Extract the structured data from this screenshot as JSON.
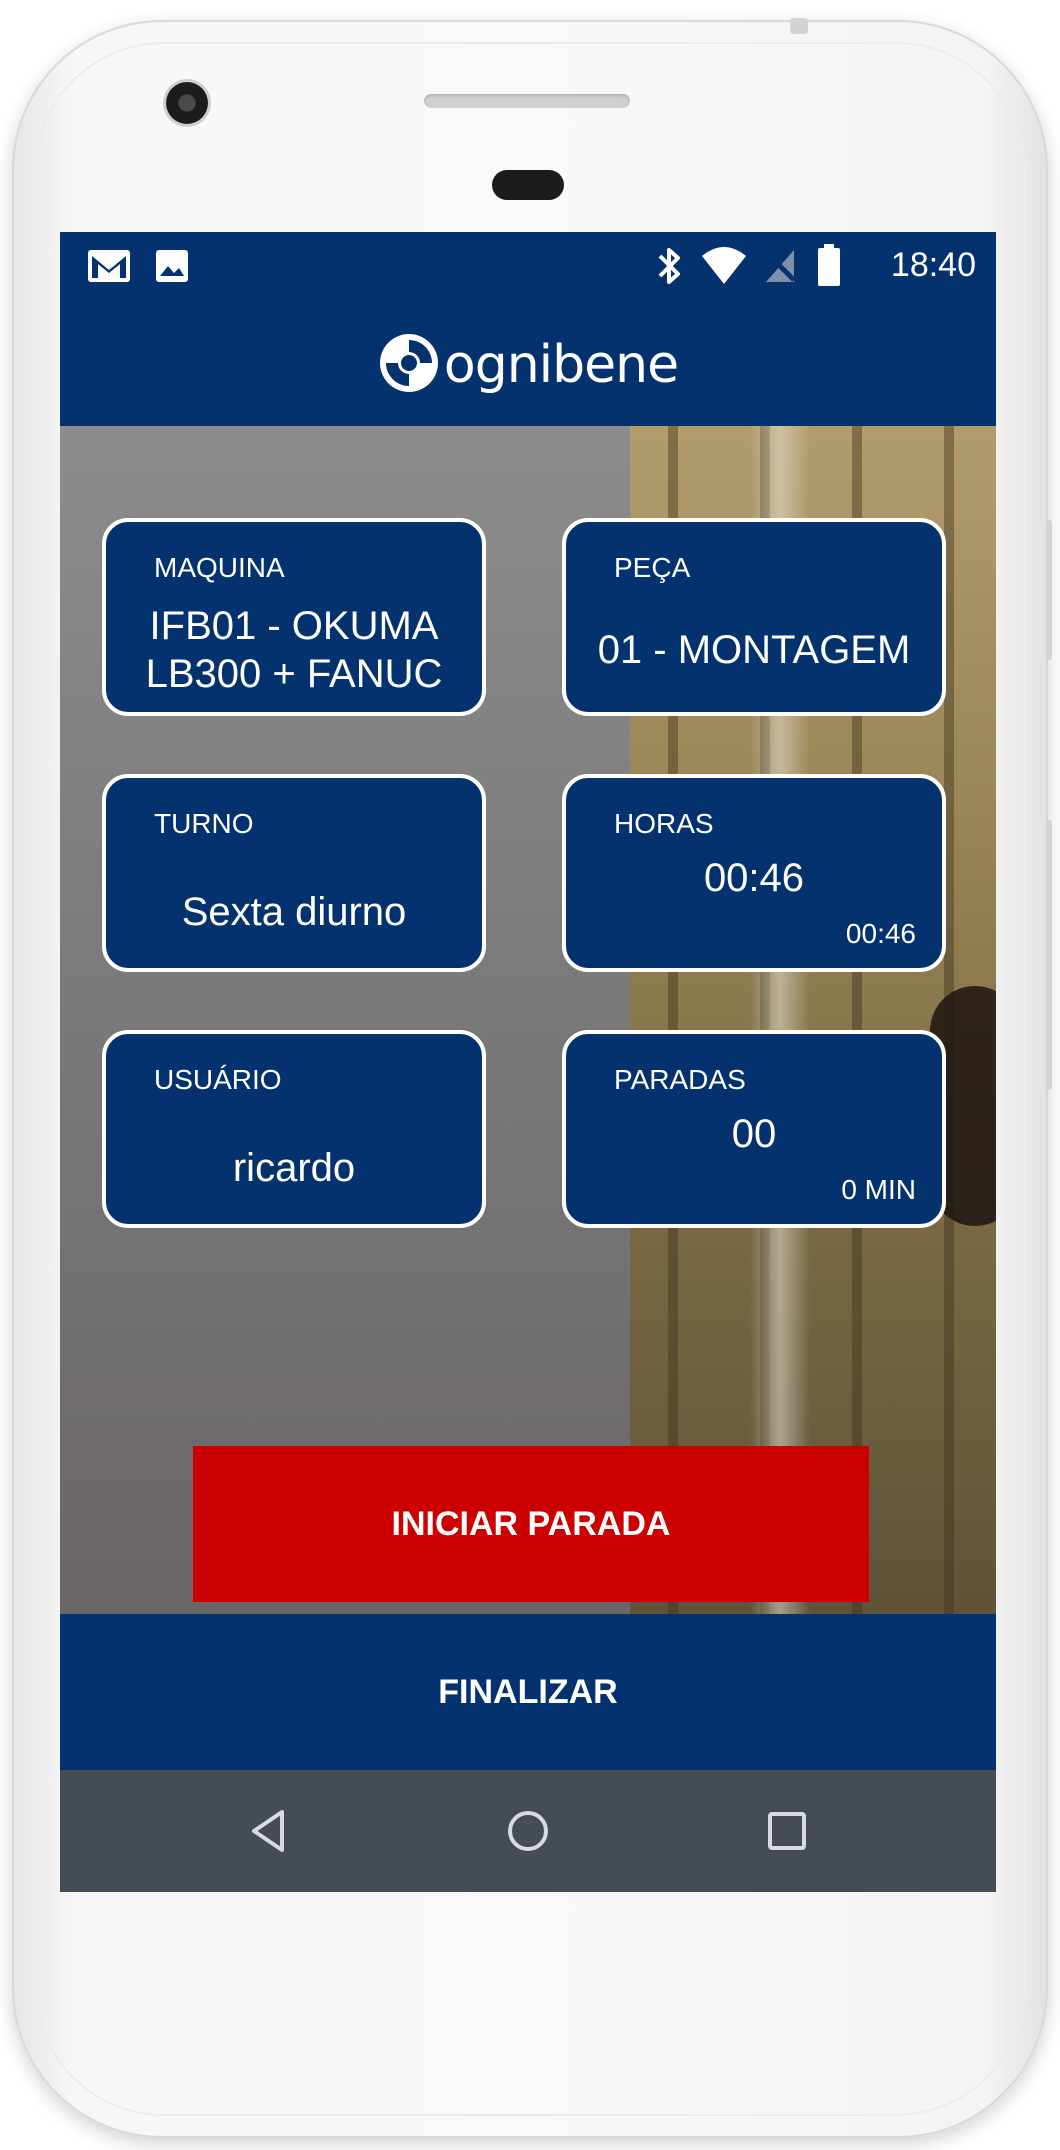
{
  "status_bar": {
    "time": "18:40",
    "left_icons": [
      "gmail-icon",
      "image-icon"
    ],
    "right_icons": [
      "bluetooth-icon",
      "wifi-icon",
      "no-signal-icon",
      "battery-icon"
    ]
  },
  "app_bar": {
    "brand": "ognibene",
    "logo_icon": "ognibene-logo-icon"
  },
  "cards": {
    "maquina": {
      "label": "MAQUINA",
      "value": "IFB01 - OKUMA\nLB300 + FANUC"
    },
    "peca": {
      "label": "PEÇA",
      "value": "01 - MONTAGEM"
    },
    "turno": {
      "label": "TURNO",
      "value": "Sexta diurno"
    },
    "horas": {
      "label": "HORAS",
      "value": "00:46",
      "sub": "00:46"
    },
    "usuario": {
      "label": "USUÁRIO",
      "value": "ricardo"
    },
    "paradas": {
      "label": "PARADAS",
      "value": "00",
      "sub": "0 MIN"
    }
  },
  "actions": {
    "iniciar_parada": "INICIAR PARADA",
    "finalizar": "FINALIZAR"
  },
  "nav": {
    "icons": [
      "back-icon",
      "home-icon",
      "recents-icon"
    ]
  },
  "colors": {
    "primary": "#04326f",
    "danger": "#cc0000",
    "nav_bar": "#454c54"
  }
}
